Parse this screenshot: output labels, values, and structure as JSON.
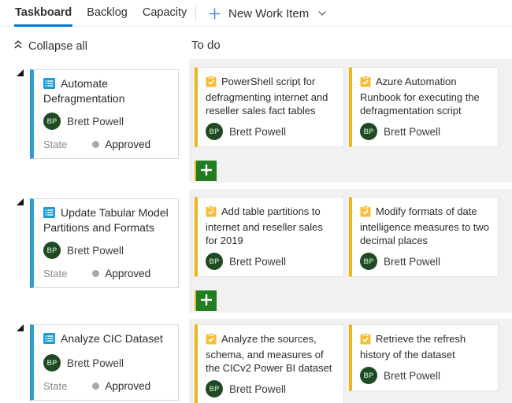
{
  "header": {
    "tabs": [
      {
        "label": "Taskboard",
        "active": true
      },
      {
        "label": "Backlog",
        "active": false
      },
      {
        "label": "Capacity",
        "active": false
      }
    ],
    "new_work_item_label": "New Work Item"
  },
  "toolbar": {
    "collapse_all_label": "Collapse all"
  },
  "board": {
    "columns": [
      {
        "label": "To do"
      }
    ],
    "rows": [
      {
        "parent": {
          "type": "user-story",
          "title": "Automate Defragmentation",
          "assignee": {
            "initials": "BP",
            "name": "Brett Powell"
          },
          "state_label": "State",
          "state": "Approved"
        },
        "tasks": [
          {
            "type": "task",
            "title": "PowerShell script for defragmenting internet and reseller sales fact tables",
            "assignee": {
              "initials": "BP",
              "name": "Brett Powell"
            }
          },
          {
            "type": "task",
            "title": "Azure Automation Runbook for executing the defragmentation script",
            "assignee": {
              "initials": "BP",
              "name": "Brett Powell"
            }
          }
        ]
      },
      {
        "parent": {
          "type": "user-story",
          "title": "Update Tabular Model Partitions and Formats",
          "assignee": {
            "initials": "BP",
            "name": "Brett Powell"
          },
          "state_label": "State",
          "state": "Approved"
        },
        "tasks": [
          {
            "type": "task",
            "title": "Add table partitions to internet and reseller sales for 2019",
            "assignee": {
              "initials": "BP",
              "name": "Brett Powell"
            }
          },
          {
            "type": "task",
            "title": "Modify formats of date intelligence measures to two decimal places",
            "assignee": {
              "initials": "BP",
              "name": "Brett Powell"
            }
          }
        ]
      },
      {
        "parent": {
          "type": "user-story",
          "title": "Analyze CIC Dataset",
          "assignee": {
            "initials": "BP",
            "name": "Brett Powell"
          },
          "state_label": "State",
          "state": "Approved"
        },
        "tasks": [
          {
            "type": "task",
            "title": "Analyze the sources, schema, and measures of the CICv2 Power BI dataset",
            "assignee": {
              "initials": "BP",
              "name": "Brett Powell"
            }
          },
          {
            "type": "task",
            "title": "Retrieve the refresh history of the dataset",
            "assignee": {
              "initials": "BP",
              "name": "Brett Powell"
            }
          }
        ]
      }
    ]
  },
  "colors": {
    "accent_blue": "#0078D4",
    "story_accent": "#2F9BD8",
    "story_icon_blue": "#1E9BD7",
    "task_accent": "#EFB51D",
    "task_icon_yellow": "#F4BE37",
    "add_button_green": "#217D22",
    "avatar_green": "#1F4A23",
    "state_dot_gray": "#A9A9A9",
    "lane_background": "#F1F1F1"
  }
}
